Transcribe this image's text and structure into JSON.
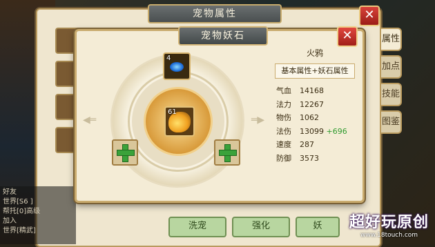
{
  "outer_window": {
    "title": "宠物属性",
    "close_label": "✕",
    "side_tabs": [
      "属性",
      "加点",
      "技能",
      "图鉴"
    ],
    "bottom_buttons": [
      "洗宠",
      "强化",
      "妖"
    ]
  },
  "chat": {
    "lines": [
      "好友",
      "世界[S6 ] ",
      "帮托[0]高级",
      "加入",
      "世界[精武] "
    ]
  },
  "dialog": {
    "title": "宠物妖石",
    "close_label": "✕",
    "stone": {
      "count": "4",
      "icon": "blue-stone-icon"
    },
    "pet": {
      "level": "61",
      "icon": "fire-crow-icon"
    },
    "add_slots": [
      "+",
      "+"
    ]
  },
  "pet_info": {
    "name": "火鸦",
    "attr_button": "基本属性+妖石属性",
    "stats": [
      {
        "label": "气血",
        "value": "14168",
        "bonus": ""
      },
      {
        "label": "法力",
        "value": "12267",
        "bonus": ""
      },
      {
        "label": "物伤",
        "value": "1062",
        "bonus": ""
      },
      {
        "label": "法伤",
        "value": "13099",
        "bonus": "+696"
      },
      {
        "label": "速度",
        "value": "287",
        "bonus": ""
      },
      {
        "label": "防御",
        "value": "3573",
        "bonus": ""
      }
    ]
  },
  "watermark": {
    "text": "超好玩原创",
    "url": "www.18touch.com"
  },
  "colors": {
    "accent_gold": "#c9ab6e",
    "close_red": "#c0302a",
    "bonus_green": "#2f9b2f",
    "plus_green": "#3aa23a"
  }
}
